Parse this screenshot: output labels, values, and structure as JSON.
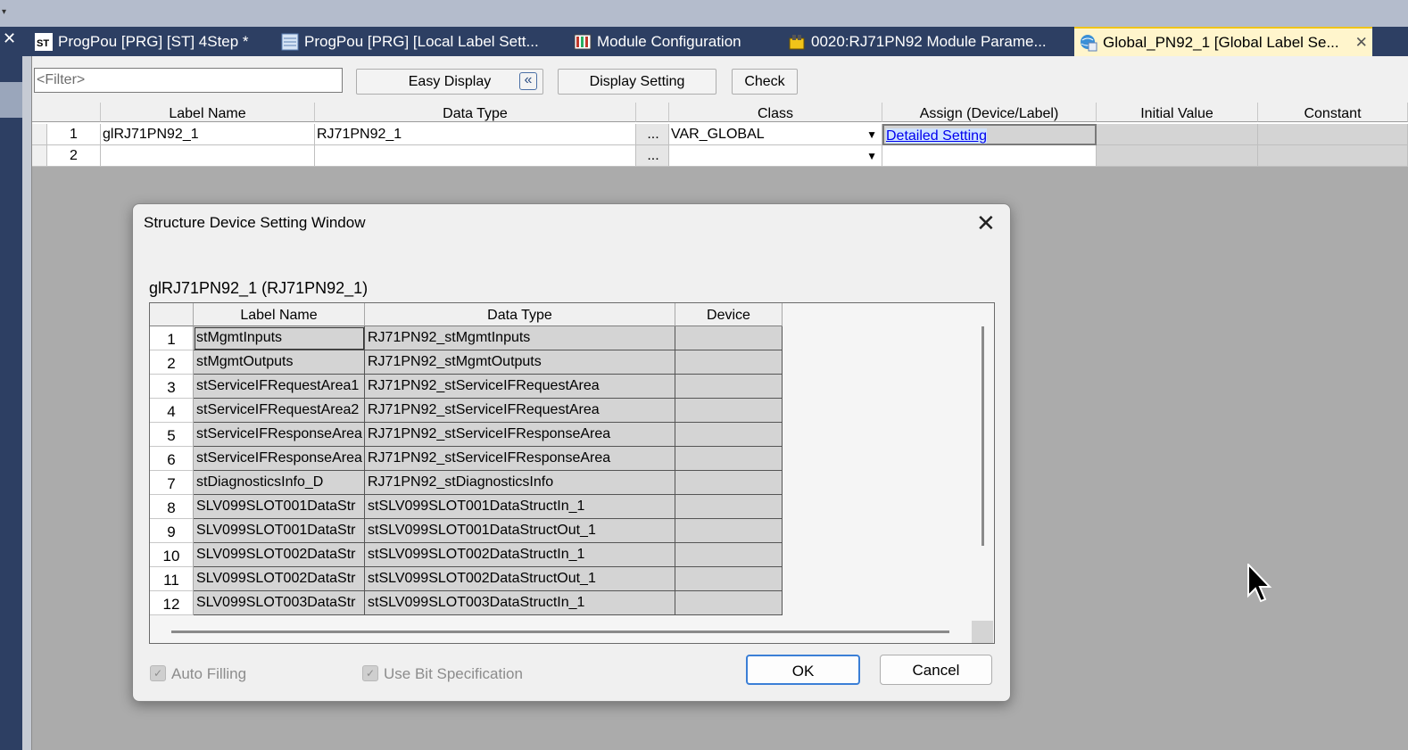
{
  "tabs": [
    {
      "label": "ProgPou [PRG] [ST] 4Step *",
      "icon": "st-icon"
    },
    {
      "label": "ProgPou [PRG] [Local Label Sett...",
      "icon": "local-label-icon"
    },
    {
      "label": "Module Configuration",
      "icon": "module-config-icon"
    },
    {
      "label": "0020:RJ71PN92 Module Parame...",
      "icon": "module-parameter-icon"
    },
    {
      "label": "Global_PN92_1 [Global Label Se...",
      "icon": "global-label-icon",
      "active": true
    }
  ],
  "toolbar": {
    "filter_placeholder": "<Filter>",
    "easy_display": "Easy Display",
    "collapse_glyph": "«",
    "display_setting": "Display Setting",
    "check": "Check"
  },
  "grid": {
    "columns": [
      "Label Name",
      "Data Type",
      "Class",
      "Assign (Device/Label)",
      "Initial Value",
      "Constant"
    ],
    "browse_glyph": "...",
    "rows": [
      {
        "num": "1",
        "label_name": "glRJ71PN92_1",
        "data_type": "RJ71PN92_1",
        "class": "VAR_GLOBAL",
        "assign": "Detailed Setting"
      },
      {
        "num": "2",
        "label_name": "",
        "data_type": "",
        "class": "",
        "assign": ""
      }
    ]
  },
  "dialog": {
    "title": "Structure Device Setting Window",
    "close_glyph": "✕",
    "subtitle": "glRJ71PN92_1 (RJ71PN92_1)",
    "columns": [
      "Label Name",
      "Data Type",
      "Device"
    ],
    "rows": [
      {
        "num": "1",
        "label": "stMgmtInputs",
        "type": "RJ71PN92_stMgmtInputs",
        "device": ""
      },
      {
        "num": "2",
        "label": "stMgmtOutputs",
        "type": "RJ71PN92_stMgmtOutputs",
        "device": ""
      },
      {
        "num": "3",
        "label": "stServiceIFRequestArea1",
        "type": "RJ71PN92_stServiceIFRequestArea",
        "device": ""
      },
      {
        "num": "4",
        "label": "stServiceIFRequestArea2",
        "type": "RJ71PN92_stServiceIFRequestArea",
        "device": ""
      },
      {
        "num": "5",
        "label": "stServiceIFResponseArea",
        "type": "RJ71PN92_stServiceIFResponseArea",
        "device": ""
      },
      {
        "num": "6",
        "label": "stServiceIFResponseArea",
        "type": "RJ71PN92_stServiceIFResponseArea",
        "device": ""
      },
      {
        "num": "7",
        "label": "stDiagnosticsInfo_D",
        "type": "RJ71PN92_stDiagnosticsInfo",
        "device": ""
      },
      {
        "num": "8",
        "label": "SLV099SLOT001DataStr",
        "type": "stSLV099SLOT001DataStructIn_1",
        "device": ""
      },
      {
        "num": "9",
        "label": "SLV099SLOT001DataStr",
        "type": "stSLV099SLOT001DataStructOut_1",
        "device": ""
      },
      {
        "num": "10",
        "label": "SLV099SLOT002DataStr",
        "type": "stSLV099SLOT002DataStructIn_1",
        "device": ""
      },
      {
        "num": "11",
        "label": "SLV099SLOT002DataStr",
        "type": "stSLV099SLOT002DataStructOut_1",
        "device": ""
      },
      {
        "num": "12",
        "label": "SLV099SLOT003DataStr",
        "type": "stSLV099SLOT003DataStructIn_1",
        "device": ""
      }
    ],
    "auto_filling": "Auto Filling",
    "use_bit_spec": "Use Bit Specification",
    "ok": "OK",
    "cancel": "Cancel"
  },
  "colors": {
    "tab_bar": "#2d3f63",
    "active_tab": "#fff5cc",
    "link": "#0000ee",
    "ok_border": "#3b7fd6"
  }
}
